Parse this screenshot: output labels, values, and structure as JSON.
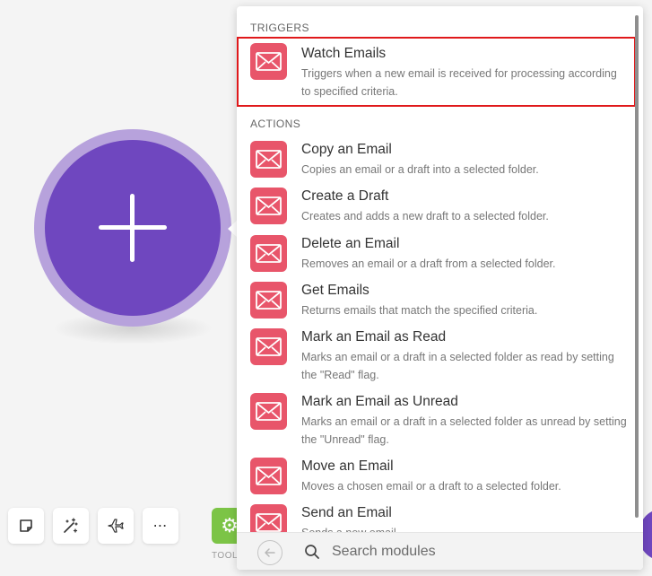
{
  "colors": {
    "accent": "#6f47bf",
    "email_icon": "#e8556a",
    "selected_outline": "#e0191b",
    "tools_green": "#7cc446"
  },
  "toolbar": {
    "tools_label": "TOOL"
  },
  "panel": {
    "triggers_heading": "TRIGGERS",
    "actions_heading": "ACTIONS",
    "triggers": [
      {
        "title": "Watch Emails",
        "description": "Triggers when a new email is received for processing according to specified criteria.",
        "icon": "envelope-icon",
        "selected": true
      }
    ],
    "actions": [
      {
        "title": "Copy an Email",
        "description": "Copies an email or a draft into a selected folder.",
        "icon": "envelope-icon"
      },
      {
        "title": "Create a Draft",
        "description": "Creates and adds a new draft to a selected folder.",
        "icon": "envelope-icon"
      },
      {
        "title": "Delete an Email",
        "description": "Removes an email or a draft from a selected folder.",
        "icon": "envelope-icon"
      },
      {
        "title": "Get Emails",
        "description": "Returns emails that match the specified criteria.",
        "icon": "envelope-icon"
      },
      {
        "title": "Mark an Email as Read",
        "description": "Marks an email or a draft in a selected folder as read by setting the \"Read\" flag.",
        "icon": "envelope-icon"
      },
      {
        "title": "Mark an Email as Unread",
        "description": "Marks an email or a draft in a selected folder as unread by setting the \"Unread\" flag.",
        "icon": "envelope-icon"
      },
      {
        "title": "Move an Email",
        "description": "Moves a chosen email or a draft to a selected folder.",
        "icon": "envelope-icon"
      },
      {
        "title": "Send an Email",
        "description": "Sends a new email",
        "icon": "envelope-icon"
      }
    ],
    "search": {
      "placeholder": "Search modules",
      "value": ""
    }
  }
}
